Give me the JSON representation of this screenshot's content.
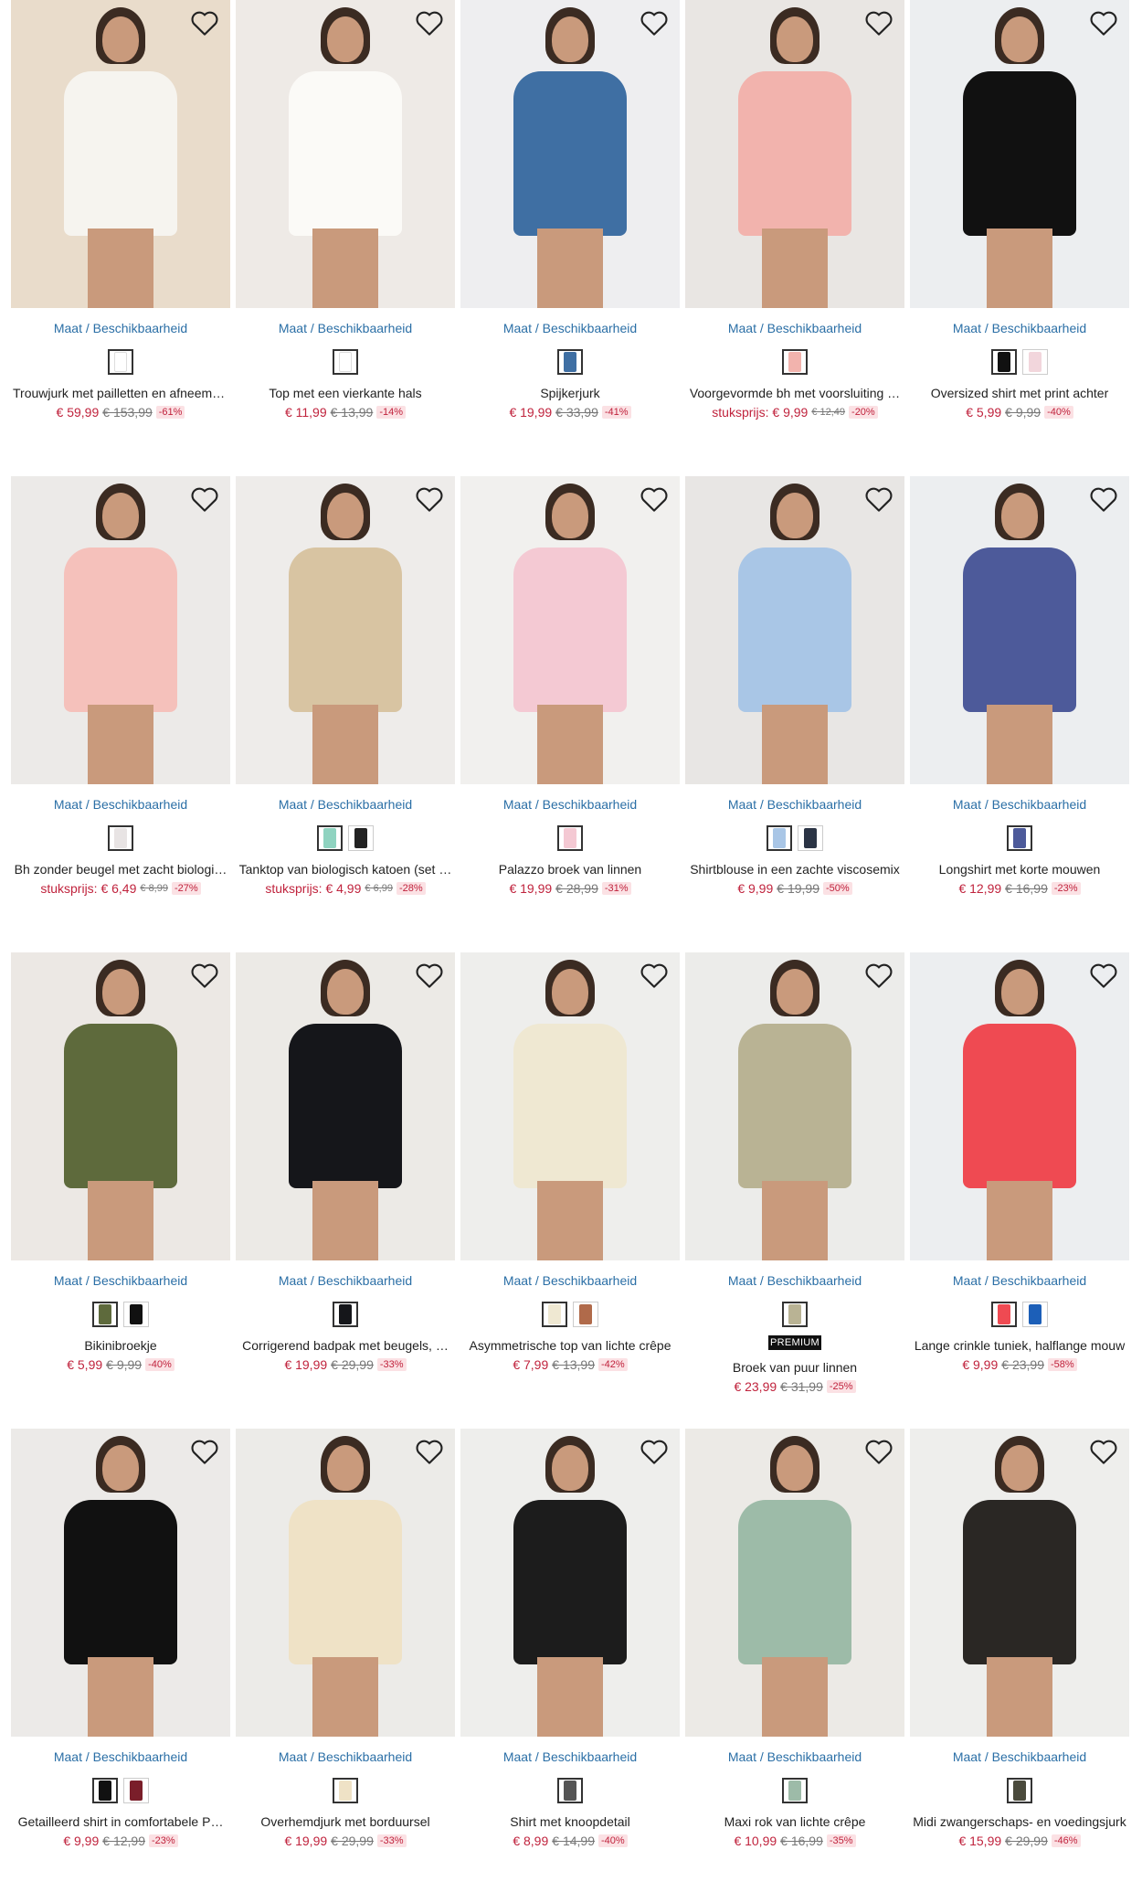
{
  "size_link_label": "Maat / Beschikbaarheid",
  "products": [
    {
      "name": "Trouwjurk met pailletten en afneemb…",
      "price_prefix": "",
      "price": "€ 59,99",
      "old_price": "€ 153,99",
      "discount": "-61%",
      "bg": "#e9dccb",
      "garment": "#f6f4ef",
      "swatches": [
        "#ffffff"
      ],
      "premium": ""
    },
    {
      "name": "Top met een vierkante hals",
      "price_prefix": "",
      "price": "€ 11,99",
      "old_price": "€ 13,99",
      "discount": "-14%",
      "bg": "#eeeae6",
      "garment": "#fbfaf7",
      "swatches": [
        "#ffffff"
      ],
      "premium": ""
    },
    {
      "name": "Spijkerjurk",
      "price_prefix": "",
      "price": "€ 19,99",
      "old_price": "€ 33,99",
      "discount": "-41%",
      "bg": "#eeeef0",
      "garment": "#3f6fa3",
      "swatches": [
        "#3f6fa3"
      ],
      "premium": ""
    },
    {
      "name": "Voorgevormde bh met voorsluiting …",
      "price_prefix": "stuksprijs:",
      "price": "€ 9,99",
      "old_price": "€ 12,49",
      "discount": "-20%",
      "bg": "#e9e6e3",
      "garment": "#f2b3ad",
      "swatches": [
        "#f2b3ad"
      ],
      "premium": ""
    },
    {
      "name": "Oversized shirt met print achter",
      "price_prefix": "",
      "price": "€ 5,99",
      "old_price": "€ 9,99",
      "discount": "-40%",
      "bg": "#eceef0",
      "garment": "#111111",
      "swatches": [
        "#111111",
        "#f2d6dc"
      ],
      "premium": ""
    },
    {
      "name": "Bh zonder beugel met zacht biologi…",
      "price_prefix": "stuksprijs:",
      "price": "€ 6,49",
      "old_price": "€ 8,99",
      "discount": "-27%",
      "bg": "#eceae8",
      "garment": "#f5c1bb",
      "swatches": [
        "#e8e4e4"
      ],
      "premium": ""
    },
    {
      "name": "Tanktop van biologisch katoen (set …",
      "price_prefix": "stuksprijs:",
      "price": "€ 4,99",
      "old_price": "€ 6,99",
      "discount": "-28%",
      "bg": "#eeecea",
      "garment": "#d8c4a2",
      "swatches": [
        "#8fd3c0",
        "#222222"
      ],
      "premium": ""
    },
    {
      "name": "Palazzo broek van linnen",
      "price_prefix": "",
      "price": "€ 19,99",
      "old_price": "€ 28,99",
      "discount": "-31%",
      "bg": "#f1f0ee",
      "garment": "#f4c9d3",
      "swatches": [
        "#f4c9d3"
      ],
      "premium": ""
    },
    {
      "name": "Shirtblouse in een zachte viscosemix",
      "price_prefix": "",
      "price": "€ 9,99",
      "old_price": "€ 19,99",
      "discount": "-50%",
      "bg": "#e8e6e4",
      "garment": "#a9c6e6",
      "swatches": [
        "#a9c6e6",
        "#2b3445"
      ],
      "premium": ""
    },
    {
      "name": "Longshirt met korte mouwen",
      "price_prefix": "",
      "price": "€ 12,99",
      "old_price": "€ 16,99",
      "discount": "-23%",
      "bg": "#eceef0",
      "garment": "#4d5a9a",
      "swatches": [
        "#4d5a9a"
      ],
      "premium": ""
    },
    {
      "name": "Bikinibroekje",
      "price_prefix": "",
      "price": "€ 5,99",
      "old_price": "€ 9,99",
      "discount": "-40%",
      "bg": "#ece8e4",
      "garment": "#5e6a3c",
      "swatches": [
        "#5e6a3c",
        "#111111"
      ],
      "premium": ""
    },
    {
      "name": "Corrigerend badpak met beugels, …",
      "price_prefix": "",
      "price": "€ 19,99",
      "old_price": "€ 29,99",
      "discount": "-33%",
      "bg": "#eceae6",
      "garment": "#15161a",
      "swatches": [
        "#15161a"
      ],
      "premium": ""
    },
    {
      "name": "Asymmetrische top van lichte crêpe",
      "price_prefix": "",
      "price": "€ 7,99",
      "old_price": "€ 13,99",
      "discount": "-42%",
      "bg": "#eeeeec",
      "garment": "#efe8d2",
      "swatches": [
        "#efe8d2",
        "#b06a4a"
      ],
      "premium": ""
    },
    {
      "name": "Broek van puur linnen",
      "price_prefix": "",
      "price": "€ 23,99",
      "old_price": "€ 31,99",
      "discount": "-25%",
      "bg": "#ececea",
      "garment": "#b9b394",
      "swatches": [
        "#b9b394"
      ],
      "premium": "PREMIUM"
    },
    {
      "name": "Lange crinkle tuniek, halflange mouw",
      "price_prefix": "",
      "price": "€ 9,99",
      "old_price": "€ 23,99",
      "discount": "-58%",
      "bg": "#eceef0",
      "garment": "#ef4a52",
      "swatches": [
        "#ef4a52",
        "#1c5fb8"
      ],
      "premium": ""
    },
    {
      "name": "Getailleerd shirt in comfortabele P…",
      "price_prefix": "",
      "price": "€ 9,99",
      "old_price": "€ 12,99",
      "discount": "-23%",
      "bg": "#eceae8",
      "garment": "#111111",
      "swatches": [
        "#111111",
        "#7a1e2a"
      ],
      "premium": ""
    },
    {
      "name": "Overhemdjurk met borduursel",
      "price_prefix": "",
      "price": "€ 19,99",
      "old_price": "€ 29,99",
      "discount": "-33%",
      "bg": "#ecebe8",
      "garment": "#efe2c6",
      "swatches": [
        "#efe2c6"
      ],
      "premium": ""
    },
    {
      "name": "Shirt met knoopdetail",
      "price_prefix": "",
      "price": "€ 8,99",
      "old_price": "€ 14,99",
      "discount": "-40%",
      "bg": "#eeeeec",
      "garment": "#1c1c1c",
      "swatches": [
        "#555555"
      ],
      "premium": ""
    },
    {
      "name": "Maxi rok van lichte crêpe",
      "price_prefix": "",
      "price": "€ 10,99",
      "old_price": "€ 16,99",
      "discount": "-35%",
      "bg": "#eceae6",
      "garment": "#9dbba8",
      "swatches": [
        "#9dbba8"
      ],
      "premium": ""
    },
    {
      "name": "Midi zwangerschaps- en voedingsjurk",
      "price_prefix": "",
      "price": "€ 15,99",
      "old_price": "€ 29,99",
      "discount": "-46%",
      "bg": "#eeeeec",
      "garment": "#2a2724",
      "swatches": [
        "#4a4a3c"
      ],
      "premium": ""
    }
  ]
}
